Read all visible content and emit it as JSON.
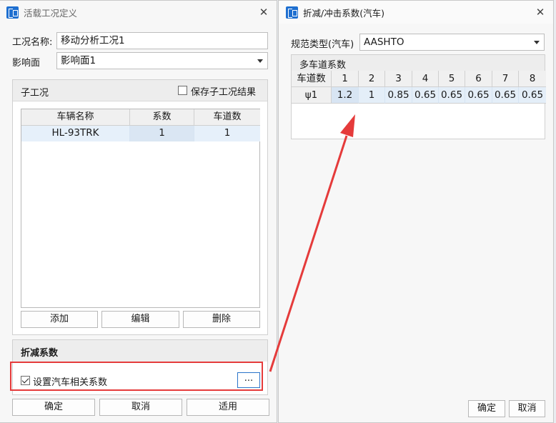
{
  "left_dialog": {
    "title": "活载工况定义",
    "case_name_label": "工况名称:",
    "case_name_value": "移动分析工况1",
    "influence_label": "影响面",
    "influence_value": "影响面1",
    "subcase": {
      "title": "子工况",
      "save_result_label": "保存子工况结果",
      "save_result_checked": false,
      "columns": [
        "车辆名称",
        "系数",
        "车道数"
      ],
      "rows": [
        [
          "HL-93TRK",
          "1",
          "1"
        ]
      ],
      "add_button": "添加",
      "edit_button": "编辑",
      "delete_button": "删除"
    },
    "reduction": {
      "title": "折减系数",
      "set_vehicle_label": "设置汽车相关系数",
      "set_vehicle_checked": true,
      "more_button": "..."
    },
    "ok_button": "确定",
    "cancel_button": "取消",
    "apply_button": "适用"
  },
  "right_dialog": {
    "title": "折减/冲击系数(汽车)",
    "spec_type_label": "规范类型(汽车)",
    "spec_type_value": "AASHTO",
    "multilane_title": "多车道系数",
    "row_header_label": "车道数",
    "lane_columns": [
      "1",
      "2",
      "3",
      "4",
      "5",
      "6",
      "7",
      "8"
    ],
    "psi_label": "ψ1",
    "psi_values": [
      "1.2",
      "1",
      "0.85",
      "0.65",
      "0.65",
      "0.65",
      "0.65",
      "0.65"
    ],
    "ok_button": "确定",
    "cancel_button": "取消"
  },
  "colors": {
    "highlight": "#e53b3b",
    "accent": "#1e6fd0"
  }
}
